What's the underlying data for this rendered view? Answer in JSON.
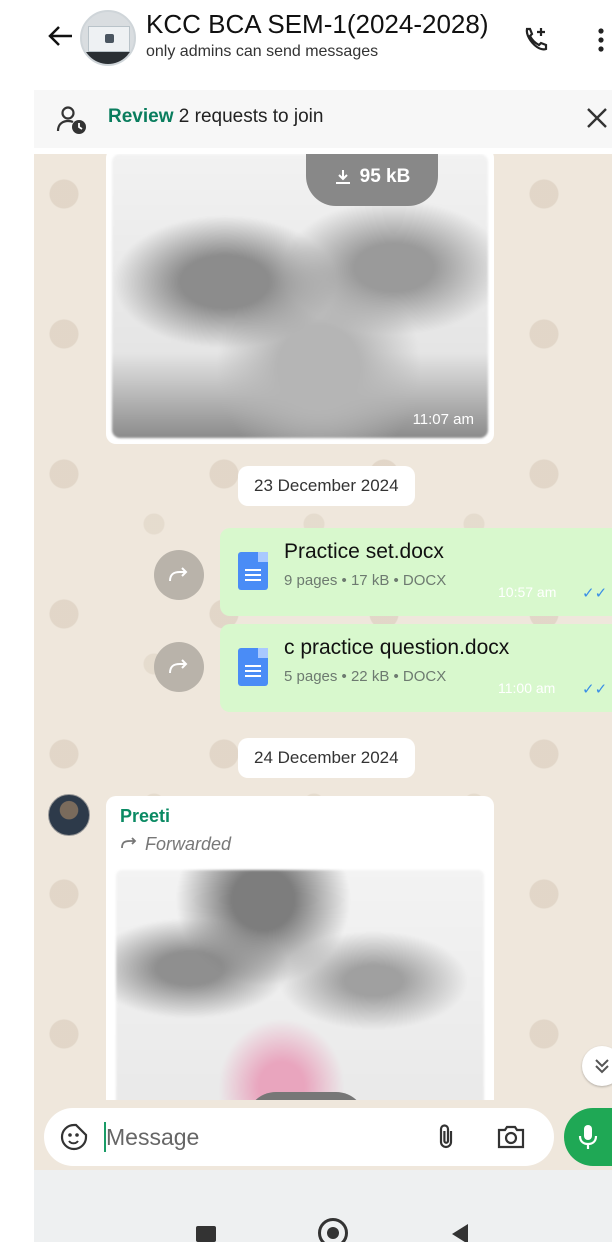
{
  "header": {
    "title": "KCC BCA SEM-1(2024-2028)",
    "subtitle": "only admins can send messages",
    "icons": [
      "back-arrow-icon",
      "add-call-icon",
      "more-vert-icon"
    ]
  },
  "requests": {
    "review_label": "Review",
    "text": "2 requests to join"
  },
  "chat": {
    "image_message": {
      "download_size": "95 kB",
      "time": "11:07 am"
    },
    "date_1": "23 December 2024",
    "documents": [
      {
        "name": "Practice set.docx",
        "meta": "9 pages • 17 kB • DOCX",
        "time": "10:57 am",
        "ticks": "✓✓"
      },
      {
        "name": "c practice question.docx",
        "meta": "5 pages • 22 kB • DOCX",
        "time": "11:00 am",
        "ticks": "✓✓"
      }
    ],
    "date_2": "24 December 2024",
    "incoming": {
      "sender": "Preeti",
      "forwarded_label": "Forwarded"
    }
  },
  "composer": {
    "placeholder": "Message"
  },
  "colors": {
    "accent_green": "#1fa855",
    "sender_green": "#0a8a63",
    "outgoing_bubble": "#d8f8cd",
    "chat_background": "#efe7dc",
    "tick_blue": "#3a8ee6"
  }
}
